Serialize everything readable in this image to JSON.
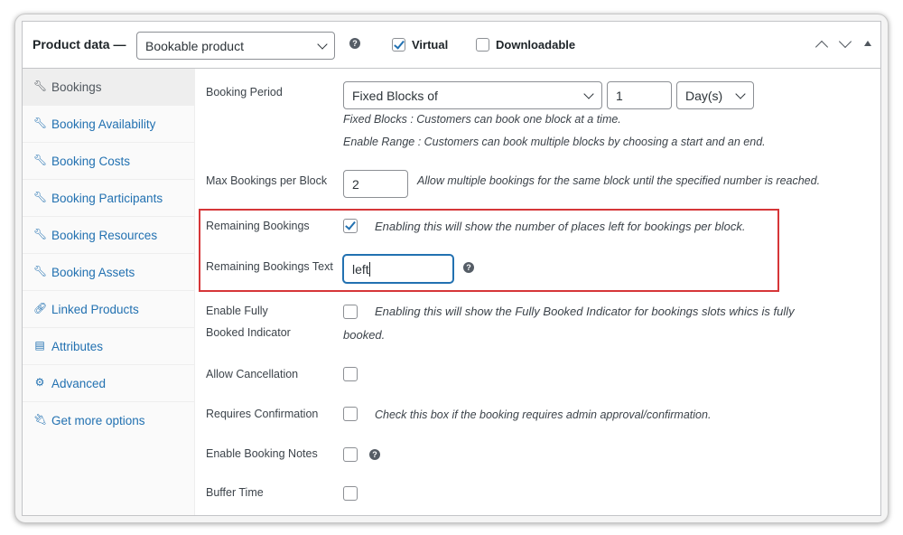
{
  "header": {
    "title": "Product data —",
    "product_type": "Bookable product",
    "virtual_label": "Virtual",
    "virtual_checked": true,
    "downloadable_label": "Downloadable",
    "downloadable_checked": false
  },
  "sidebar": {
    "items": [
      {
        "label": "Bookings",
        "icon": "wrench-icon",
        "active": true
      },
      {
        "label": "Booking Availability",
        "icon": "wrench-icon"
      },
      {
        "label": "Booking Costs",
        "icon": "wrench-icon"
      },
      {
        "label": "Booking Participants",
        "icon": "wrench-icon"
      },
      {
        "label": "Booking Resources",
        "icon": "wrench-icon"
      },
      {
        "label": "Booking Assets",
        "icon": "wrench-icon"
      },
      {
        "label": "Linked Products",
        "icon": "link-icon"
      },
      {
        "label": "Attributes",
        "icon": "list-icon"
      },
      {
        "label": "Advanced",
        "icon": "gear-icon"
      },
      {
        "label": "Get more options",
        "icon": "plugin-icon"
      }
    ]
  },
  "fields": {
    "booking_period": {
      "label": "Booking Period",
      "type_value": "Fixed Blocks of",
      "number_value": "1",
      "unit_value": "Day(s)",
      "desc1": "Fixed Blocks : Customers can book one block at a time.",
      "desc2": "Enable Range : Customers can book multiple blocks by choosing a start and an end."
    },
    "max_bookings": {
      "label": "Max Bookings per Block",
      "value": "2",
      "desc": "Allow multiple bookings for the same block until the specified number is reached."
    },
    "remaining_bookings": {
      "label": "Remaining Bookings",
      "checked": true,
      "desc": "Enabling this will show the number of places left for bookings per block."
    },
    "remaining_text": {
      "label": "Remaining Bookings Text",
      "value": "left"
    },
    "fully_booked": {
      "label_line1": "Enable Fully",
      "label_line2": "Booked Indicator",
      "desc_line1": "Enabling this will show the Fully Booked Indicator for bookings slots whics is fully",
      "desc_line2": "booked."
    },
    "allow_cancellation": {
      "label": "Allow Cancellation"
    },
    "requires_confirmation": {
      "label": "Requires Confirmation",
      "desc": "Check this box if the booking requires admin approval/confirmation."
    },
    "booking_notes": {
      "label": "Enable Booking Notes"
    },
    "buffer_time": {
      "label": "Buffer Time"
    }
  },
  "colors": {
    "accent": "#2271b1",
    "highlight_border": "#d63638"
  }
}
